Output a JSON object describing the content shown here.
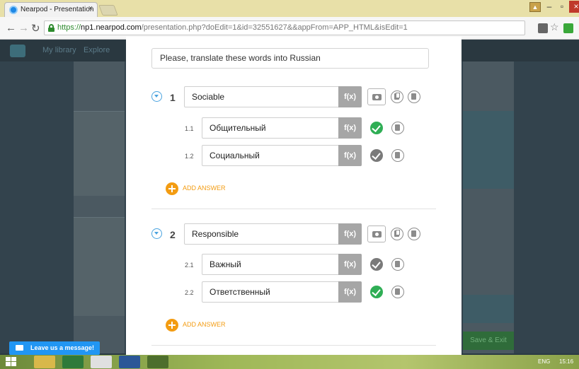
{
  "browser": {
    "tab_title": "Nearpod - Presentation",
    "tab_close": "×",
    "url_scheme": "https://",
    "url_host": "np1.nearpod.com",
    "url_path": "/presentation.php?doEdit=1&id=32551627&&appFrom=APP_HTML&isEdit=1"
  },
  "background": {
    "nav": [
      "My library",
      "Explore"
    ],
    "save_label": "Save & Exit"
  },
  "modal": {
    "instruction": "Please, translate these words into Russian",
    "fx_label": "f(x)",
    "add_answer_label": "ADD ANSWER",
    "questions": [
      {
        "number": "1",
        "prompt": "Sociable",
        "answers": [
          {
            "number": "1.1",
            "text": "Общительный",
            "correct": true
          },
          {
            "number": "1.2",
            "text": "Социальный",
            "correct": false
          }
        ]
      },
      {
        "number": "2",
        "prompt": "Responsible",
        "answers": [
          {
            "number": "2.1",
            "text": "Важный",
            "correct": false
          },
          {
            "number": "2.2",
            "text": "Ответственный",
            "correct": true
          }
        ]
      }
    ]
  },
  "chat": {
    "label": "Leave us a message!"
  },
  "taskbar": {
    "language": "ENG",
    "time": "15:16"
  },
  "colors": {
    "accent_blue": "#4aa3df",
    "correct_green": "#2fae55",
    "add_orange": "#f39c12",
    "chat_blue": "#2196f3"
  }
}
